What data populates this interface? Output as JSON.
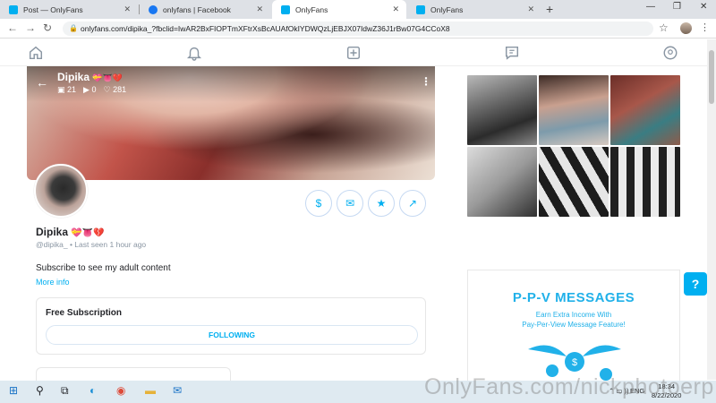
{
  "browser": {
    "tabs": [
      {
        "title": "Post — OnlyFans"
      },
      {
        "title": "onlyfans | Facebook"
      },
      {
        "title": "OnlyFans"
      },
      {
        "title": "OnlyFans"
      }
    ],
    "url": "onlyfans.com/dipika_?fbclid=IwAR2BxFIOPTmXFtrXsBcAUAfOkIYDWQzLjEBJX07IdwZ36J1rBw07G4CCoX8"
  },
  "profile": {
    "name": "Dipika",
    "emoji": "💝👅💔",
    "cover_name": "Dipika",
    "photos_count": "21",
    "videos_count": "0",
    "likes_count": "281",
    "handle": "@dipika_",
    "last_seen": "Last seen 1 hour ago",
    "bio": "Subscribe to see my adult content",
    "more_info": "More info"
  },
  "subscription": {
    "title": "Free Subscription",
    "button": "FOLLOWING"
  },
  "promo": {
    "title": "P-P-V MESSAGES",
    "line1": "Earn Extra Income With",
    "line2": "Pay-Per-View Message Feature!"
  },
  "taskbar": {
    "lang": "ENG",
    "time": "18:34",
    "date": "8/22/2020"
  },
  "watermark": "OnlyFans.com/nickphotoerp",
  "colors": {
    "accent": "#00aff0",
    "promo": "#21b1e9"
  }
}
